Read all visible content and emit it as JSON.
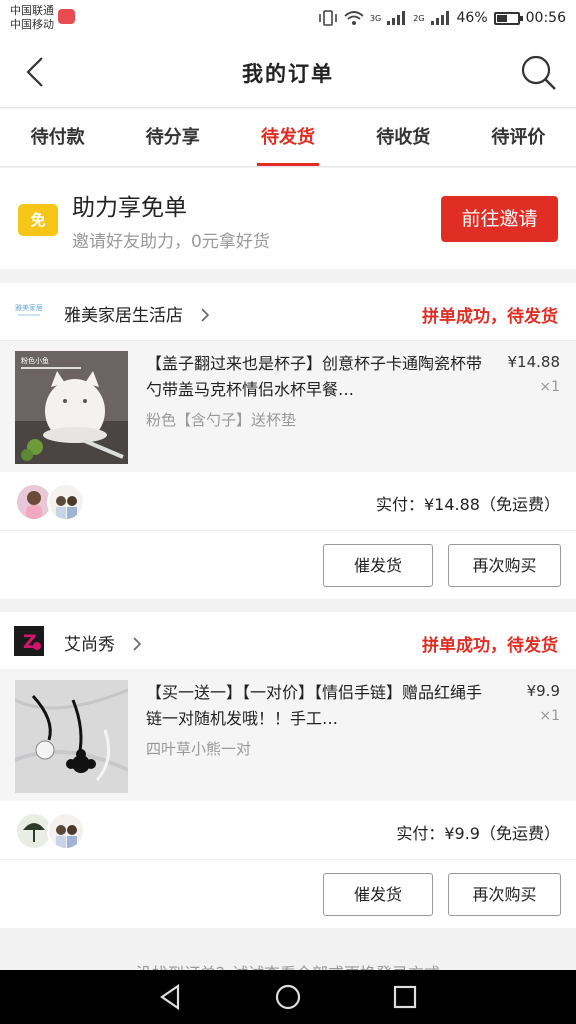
{
  "status_bar": {
    "carrier1": "中国联通",
    "carrier2": "中国移动",
    "net1": "3G",
    "net2": "2G",
    "battery": "46%",
    "time": "00:56"
  },
  "header": {
    "title": "我的订单"
  },
  "tabs": [
    {
      "label": "待付款",
      "active": false
    },
    {
      "label": "待分享",
      "active": false
    },
    {
      "label": "待发货",
      "active": true
    },
    {
      "label": "待收货",
      "active": false
    },
    {
      "label": "待评价",
      "active": false
    }
  ],
  "promo": {
    "icon_text": "免",
    "title": "助力享免单",
    "subtitle": "邀请好友助力，0元拿好货",
    "button": "前往邀请"
  },
  "orders": [
    {
      "shop_name": "雅美家居生活店",
      "shop_logo_text": "雅美家居",
      "status": "拼单成功，待发货",
      "product_title": "【盖子翻过来也是杯子】创意杯子卡通陶瓷杯带勺带盖马克杯情侣水杯早餐…",
      "product_img_text": "粉色小鱼",
      "spec": "粉色【含勺子】送杯垫",
      "price": "¥14.88",
      "qty": "×1",
      "paid": "实付：¥14.88（免运费）",
      "btn_remind": "催发货",
      "btn_rebuy": "再次购买"
    },
    {
      "shop_name": "艾尚秀",
      "shop_logo_text": "Z",
      "status": "拼单成功，待发货",
      "product_title": "【买一送一】【一对价】【情侣手链】赠品红绳手链一对随机发哦！！手工…",
      "spec": "四叶草小熊一对",
      "price": "¥9.9",
      "qty": "×1",
      "paid": "实付：¥9.9（免运费）",
      "btn_remind": "催发货",
      "btn_rebuy": "再次购买"
    }
  ],
  "bottom_hint": "没找到订单？试试查看全部或更换登录方式",
  "colors": {
    "accent": "#e02e24",
    "promo_icon": "#f5c518"
  }
}
